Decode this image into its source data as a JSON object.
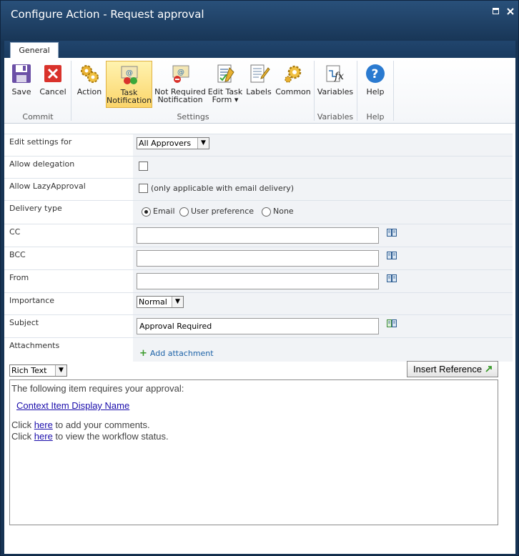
{
  "window": {
    "title": "Configure Action - Request approval"
  },
  "tabs": [
    {
      "label": "General"
    }
  ],
  "ribbon": {
    "buttons": {
      "save": "Save",
      "cancel": "Cancel",
      "action": "Action",
      "task_notification_1": "Task",
      "task_notification_2": "Notification",
      "not_required_1": "Not Required",
      "not_required_2": "Notification",
      "edit_task_form_1": "Edit Task",
      "edit_task_form_2": "Form",
      "labels": "Labels",
      "common": "Common",
      "variables": "Variables",
      "help": "Help"
    },
    "groups": {
      "commit": "Commit",
      "settings": "Settings",
      "variables": "Variables",
      "help": "Help"
    }
  },
  "form": {
    "edit_settings_for": {
      "label": "Edit settings for",
      "value": "All Approvers"
    },
    "allow_delegation": {
      "label": "Allow delegation",
      "checked": false
    },
    "allow_lazy": {
      "label": "Allow LazyApproval",
      "note": "(only applicable with email delivery)",
      "checked": false
    },
    "delivery_type": {
      "label": "Delivery type",
      "options": [
        "Email",
        "User preference",
        "None"
      ],
      "selected": "Email"
    },
    "cc": {
      "label": "CC",
      "value": ""
    },
    "bcc": {
      "label": "BCC",
      "value": ""
    },
    "from": {
      "label": "From",
      "value": ""
    },
    "importance": {
      "label": "Importance",
      "value": "Normal"
    },
    "subject": {
      "label": "Subject",
      "value": "Approval Required"
    },
    "attachments": {
      "label": "Attachments",
      "add_label": "Add attachment"
    }
  },
  "body": {
    "format": "Rich Text",
    "insert_reference": "Insert Reference",
    "line1": "The following item requires your approval:",
    "context_link": "Context Item Display Name",
    "click1_pre": "Click ",
    "click1_link": "here",
    "click1_post": " to add your comments.",
    "click2_pre": "Click ",
    "click2_link": "here",
    "click2_post": " to view the workflow status."
  },
  "colors": {
    "title_bar": "#1b3a5c",
    "active_button": "#fbd56a",
    "link": "#1a0dab"
  }
}
